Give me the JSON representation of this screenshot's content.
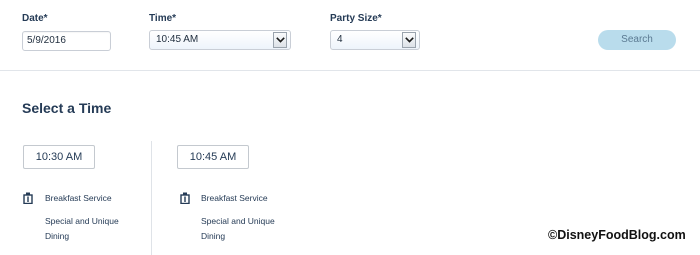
{
  "form": {
    "date": {
      "label": "Date*",
      "value": "5/9/2016"
    },
    "time": {
      "label": "Time*",
      "value": "10:45 AM"
    },
    "party_size": {
      "label": "Party Size*",
      "value": "4"
    },
    "search_label": "Search"
  },
  "results": {
    "title": "Select a Time",
    "slots": [
      {
        "time": "10:30 AM",
        "meal": "Breakfast Service",
        "description_line1": "Special and Unique",
        "description_line2": "Dining"
      },
      {
        "time": "10:45 AM",
        "meal": "Breakfast Service",
        "description_line1": "Special and Unique",
        "description_line2": "Dining"
      }
    ]
  },
  "watermark": "©DisneyFoodBlog.com",
  "icons": {
    "meal": "breakfast-utensil-icon",
    "dropdown": "chevron-down-icon"
  },
  "colors": {
    "text": "#253b56",
    "search_button": "#b9dcec",
    "search_button_text": "#5b7a92",
    "border": "#c9ced6"
  }
}
